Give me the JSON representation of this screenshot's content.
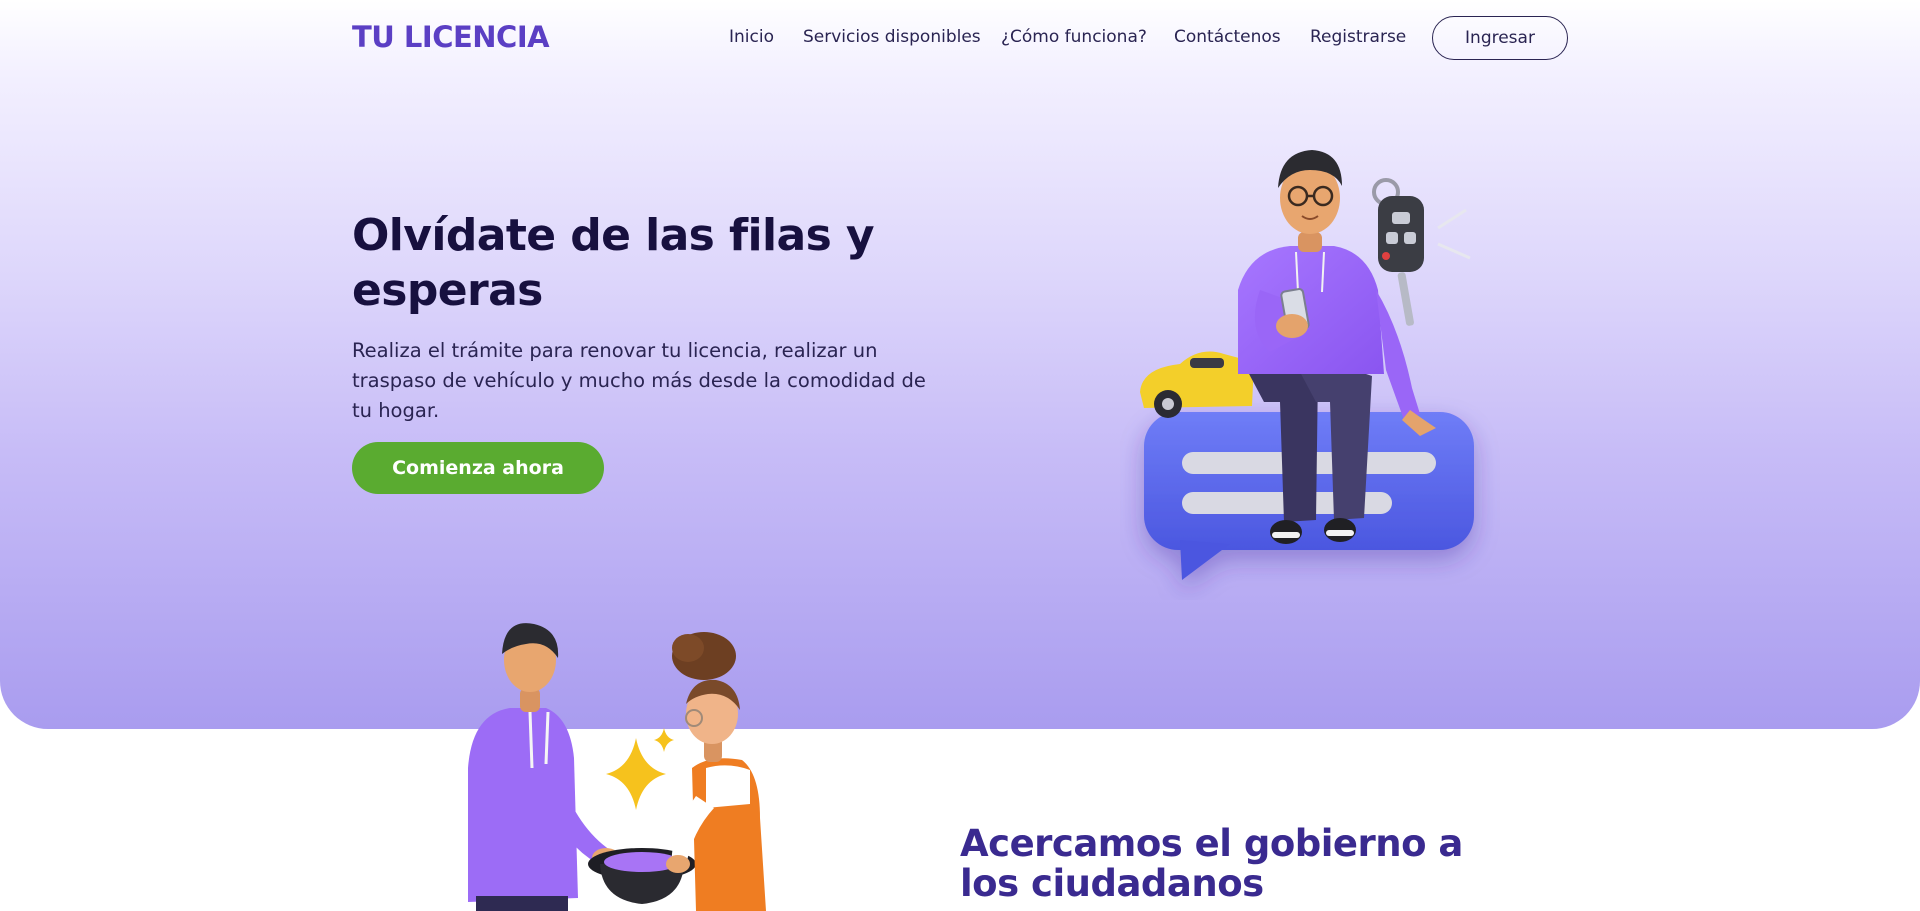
{
  "brand": {
    "name": "TU LICENCIA"
  },
  "nav": {
    "links": [
      {
        "label": "Inicio"
      },
      {
        "label": "Servicios disponibles"
      },
      {
        "label": "¿Cómo funciona?"
      },
      {
        "label": "Contáctenos"
      },
      {
        "label": "Registrarse"
      }
    ],
    "login_label": "Ingresar"
  },
  "hero": {
    "title": "Olvídate de las filas y esperas",
    "description": "Realiza el trámite para renovar tu licencia, realizar un traspaso de vehículo y mucho más desde la comodidad de tu hogar.",
    "cta_label": "Comienza ahora"
  },
  "section": {
    "title": "Acercamos el gobierno a los ciudadanos"
  },
  "colors": {
    "brand": "#5b3fc4",
    "cta": "#5aab30",
    "heading": "#17103f",
    "section_heading": "#3a2a90",
    "hero_gradient_end": "#a99cef"
  },
  "icons": {
    "main_illustration": "person-sitting-on-chat-bubble-with-car-and-key",
    "secondary_illustration": "two-people-with-magic-hat"
  }
}
